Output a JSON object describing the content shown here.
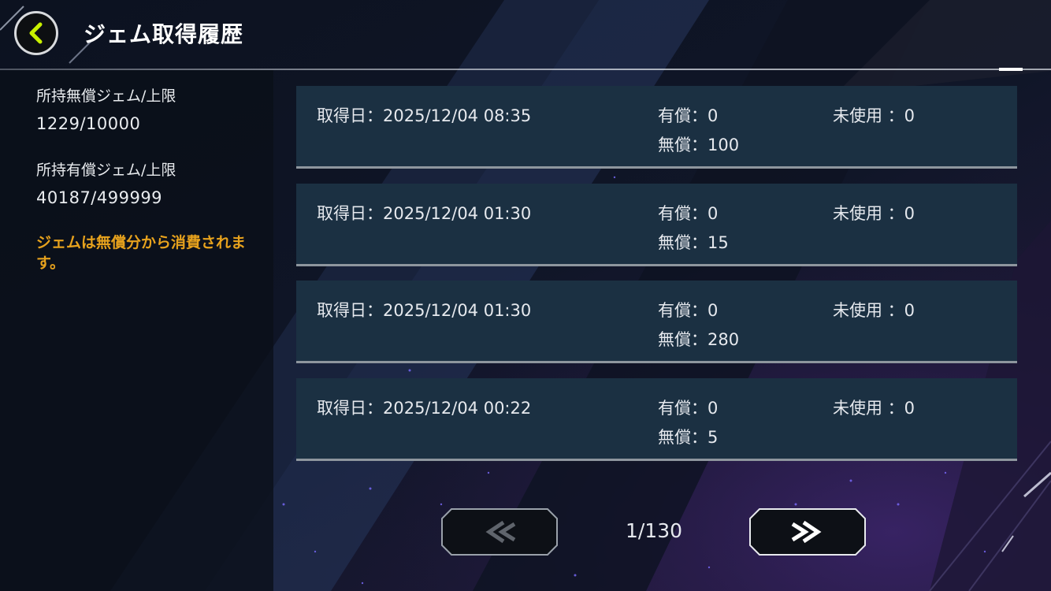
{
  "header": {
    "title": "ジェム取得履歴"
  },
  "sidebar": {
    "free_gems_label": "所持無償ジェム/上限",
    "free_gems_value": "1229/10000",
    "paid_gems_label": "所持有償ジェム/上限",
    "paid_gems_value": "40187/499999",
    "note": "ジェムは無償分から消費されます。"
  },
  "history": [
    {
      "date": "取得日：2025/12/04 08:35",
      "paid": "有償：0",
      "free": "無償：100",
      "unused": "未使用 ：0"
    },
    {
      "date": "取得日：2025/12/04 01:30",
      "paid": "有償：0",
      "free": "無償：15",
      "unused": "未使用 ：0"
    },
    {
      "date": "取得日：2025/12/04 01:30",
      "paid": "有償：0",
      "free": "無償：280",
      "unused": "未使用 ：0"
    },
    {
      "date": "取得日：2025/12/04 00:22",
      "paid": "有償：0",
      "free": "無償：5",
      "unused": "未使用 ：0"
    }
  ],
  "pager": {
    "page": "1/130",
    "prev_icon": "double-chevron-left-icon",
    "next_icon": "double-chevron-right-icon"
  },
  "icons": {
    "back": "chevron-left-icon"
  },
  "colors": {
    "accent_back": "#c8f000",
    "note": "#e7a21d",
    "entry_bg": "#1b3042"
  }
}
